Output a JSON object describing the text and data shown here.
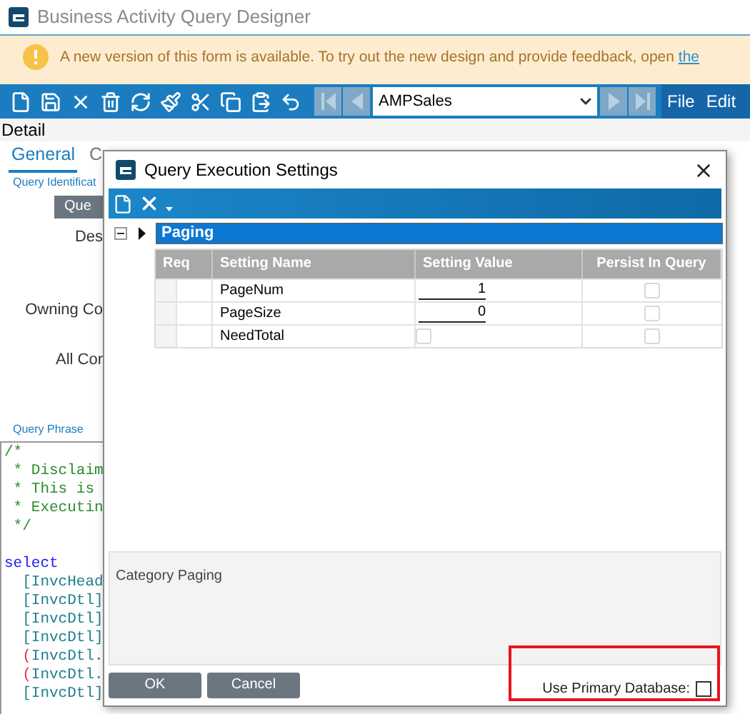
{
  "window": {
    "title": "Business Activity Query Designer"
  },
  "banner": {
    "text": "A new version of this form is available. To try out the new design and provide feedback, open ",
    "link": "the"
  },
  "toolbar": {
    "record": "AMPSales",
    "menus": [
      "File",
      "Edit"
    ]
  },
  "section": "Detail",
  "tabs": [
    {
      "label": "General",
      "selected": true
    },
    {
      "label": "C",
      "selected": false
    }
  ],
  "form": {
    "group": "Query Identificat",
    "button": "Que",
    "labels": [
      "Des",
      "Owning Co",
      "All Cor"
    ],
    "phrase_label": "Query Phrase",
    "code": [
      [
        {
          "text": "/*",
          "kind": "comment"
        }
      ],
      [
        {
          "text": " * Disclaim",
          "kind": "comment"
        }
      ],
      [
        {
          "text": " * This is ",
          "kind": "comment"
        }
      ],
      [
        {
          "text": " * Executin",
          "kind": "comment"
        }
      ],
      [
        {
          "text": " */",
          "kind": "comment"
        }
      ],
      [
        {
          "text": "select",
          "kind": "keyword",
          "gap_before": true
        }
      ],
      [
        {
          "text": "  [InvcHead",
          "kind": "ident"
        }
      ],
      [
        {
          "text": "  [InvcDtl]",
          "kind": "ident"
        }
      ],
      [
        {
          "text": "  [InvcDtl]",
          "kind": "ident"
        }
      ],
      [
        {
          "text": "  [InvcDtl]",
          "kind": "ident"
        }
      ],
      [
        {
          "text": "  (",
          "kind": "paren"
        },
        {
          "text": "InvcDtl.",
          "kind": "ident"
        }
      ],
      [
        {
          "text": "  (",
          "kind": "paren"
        },
        {
          "text": "InvcDtl.",
          "kind": "ident"
        }
      ],
      [
        {
          "text": "  [InvcDtl]",
          "kind": "ident"
        }
      ]
    ]
  },
  "dialog": {
    "title": "Query Execution Settings",
    "tree": {
      "label": "Paging",
      "expanded": true,
      "selected": true
    },
    "columns": [
      "Req",
      "Setting Name",
      "Setting Value",
      "Persist In Query"
    ],
    "rows": [
      {
        "name": "PageNum",
        "kind": "number",
        "value": "1",
        "persist": false
      },
      {
        "name": "PageSize",
        "kind": "number",
        "value": "0",
        "persist": false
      },
      {
        "name": "NeedTotal",
        "kind": "checkbox",
        "checked": false,
        "persist": false
      }
    ],
    "description": "Category Paging",
    "buttons": [
      "OK",
      "Cancel"
    ],
    "primary_db": {
      "label": "Use Primary Database:",
      "checked": false
    }
  }
}
